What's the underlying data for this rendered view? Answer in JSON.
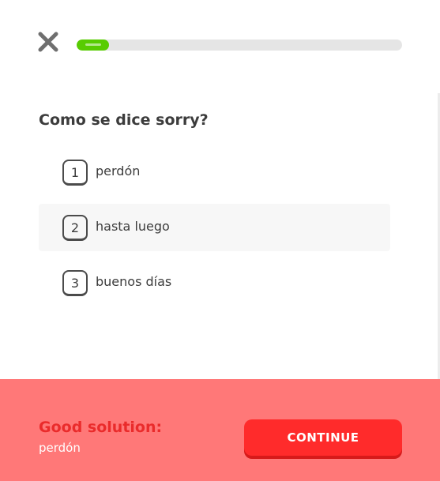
{
  "lesson": {
    "progress_percent": 10,
    "colors": {
      "progress_fill": "#58cc02",
      "track": "#e5e5e5"
    }
  },
  "close": {
    "icon": "close-icon"
  },
  "question": {
    "text": "Como se dice sorry?"
  },
  "options": [
    {
      "key": "1",
      "label": "perdón",
      "selected": false
    },
    {
      "key": "2",
      "label": "hasta luego",
      "selected": true
    },
    {
      "key": "3",
      "label": "buenos días",
      "selected": false
    }
  ],
  "feedback": {
    "title": "Good solution:",
    "answer": "perdón",
    "button_label": "CONTINUE",
    "colors": {
      "banner": "#ff7878",
      "title": "#ea2b2b",
      "button": "#ff2b2b"
    }
  }
}
